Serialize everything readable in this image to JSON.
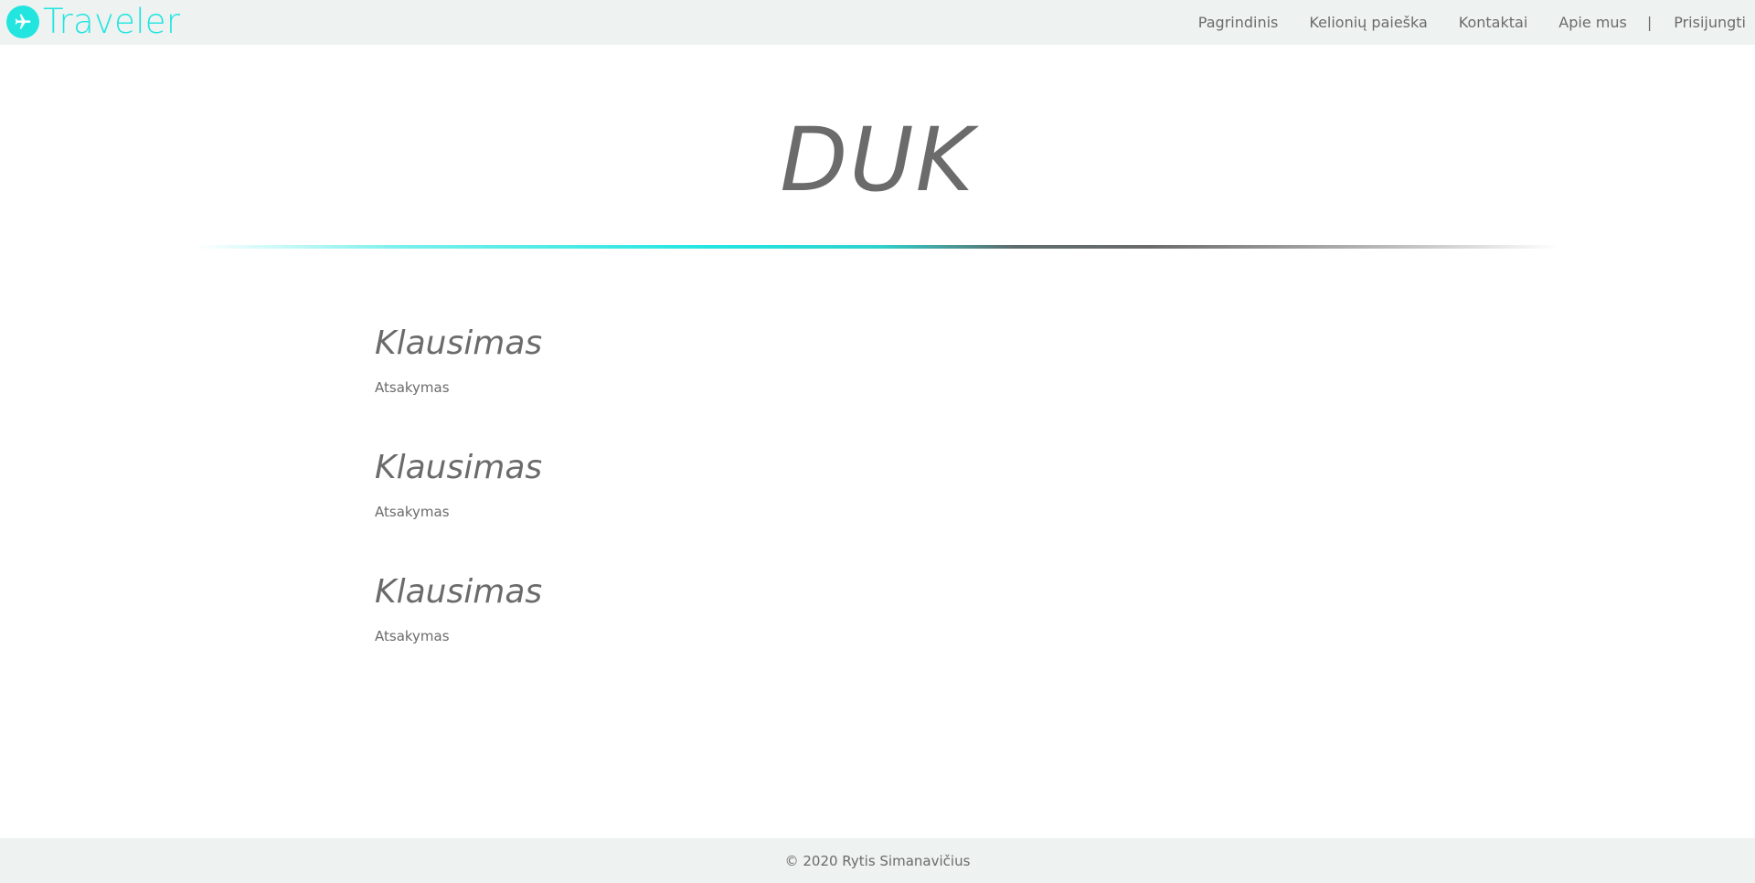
{
  "brand": {
    "name": "Traveler",
    "icon": "airplane-icon",
    "accent_color": "#22e5e0"
  },
  "nav": {
    "items": [
      {
        "label": "Pagrindinis"
      },
      {
        "label": "Kelionių paieška"
      },
      {
        "label": "Kontaktai"
      },
      {
        "label": "Apie mus"
      }
    ],
    "separator": "|",
    "login_label": "Prisijungti"
  },
  "page": {
    "title": "DUK"
  },
  "faq": [
    {
      "question": "Klausimas",
      "answer": "Atsakymas"
    },
    {
      "question": "Klausimas",
      "answer": "Atsakymas"
    },
    {
      "question": "Klausimas",
      "answer": "Atsakymas"
    }
  ],
  "footer": {
    "copyright": "© 2020 Rytis Simanavičius"
  },
  "colors": {
    "header_bg": "#eef2f0",
    "text": "#6b6b6b",
    "accent": "#22e5e0"
  }
}
